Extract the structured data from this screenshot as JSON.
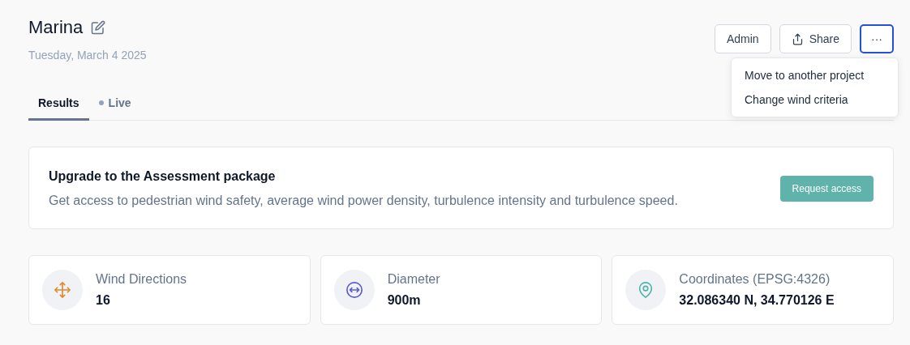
{
  "header": {
    "title": "Marina",
    "date": "Tuesday, March 4 2025"
  },
  "actions": [
    {
      "label": "Admin",
      "kind": "plain",
      "active": false
    },
    {
      "label": "Share",
      "kind": "share",
      "active": false
    },
    {
      "label": "···",
      "kind": "more",
      "active": true
    }
  ],
  "menu": {
    "open": true,
    "items": [
      "Move to another project",
      "Change wind criteria"
    ]
  },
  "tabs": [
    {
      "label": "Results",
      "selected": true,
      "dot": false
    },
    {
      "label": "Live",
      "selected": false,
      "dot": true
    }
  ],
  "banner": {
    "title": "Upgrade to the Assessment package",
    "text": "Get access to pedestrian wind safety, average wind power density, turbulence intensity and turbulence speed.",
    "button": "Request access"
  },
  "stats": [
    {
      "kind": "directions",
      "color": "#e08a2c",
      "label": "Wind Directions",
      "value": "16"
    },
    {
      "kind": "diameter",
      "color": "#5b5bd6",
      "label": "Diameter",
      "value": "900m"
    },
    {
      "kind": "location",
      "color": "#4fb3a9",
      "label": "Coordinates (EPSG:4326)",
      "value": "32.086340 N, 34.770126 E"
    }
  ]
}
